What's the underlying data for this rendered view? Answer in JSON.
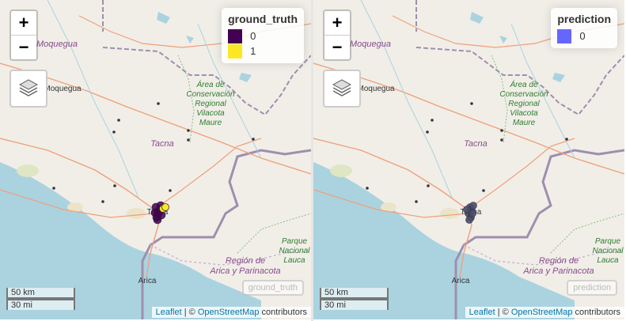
{
  "colors": {
    "land": "#f1eee8",
    "sea": "#aad3df",
    "border": "#9e8fae",
    "highway": "#f0a07a",
    "road": "#ffffff",
    "class_0": "#440154",
    "class_1": "#fde725",
    "prediction_0": "#6666ff",
    "points": "#333344"
  },
  "map": {
    "labels": {
      "moquegua_region": "Moquegua",
      "moquegua_city": "Moquegua",
      "area_conservacion": [
        "Área de",
        "Conservación",
        "Regional",
        "Vilacota",
        "Maure"
      ],
      "tacna_region": "Tacna",
      "tacna_city": "Tacna",
      "parque_lauca": [
        "Parque",
        "Nacional",
        "Lauca"
      ],
      "region_arica": [
        "Región de",
        "Arica y Parinacota"
      ],
      "arica_city": "Arica"
    },
    "zoom_in": "+",
    "zoom_out": "−",
    "layers_icon": "layers-icon",
    "scale_km": "50 km",
    "scale_mi": "30 mi",
    "attribution": {
      "leaflet": "Leaflet",
      "sep": " | © ",
      "osm": "OpenStreetMap",
      "contributors": " contributors"
    }
  },
  "left_panel": {
    "legend_title": "ground_truth",
    "legend_items": [
      {
        "label": "0",
        "color": "#440154"
      },
      {
        "label": "1",
        "color": "#fde725"
      }
    ],
    "layer_button": "ground_truth"
  },
  "right_panel": {
    "legend_title": "prediction",
    "legend_items": [
      {
        "label": "0",
        "color": "#6666ff"
      }
    ],
    "layer_button": "prediction"
  }
}
